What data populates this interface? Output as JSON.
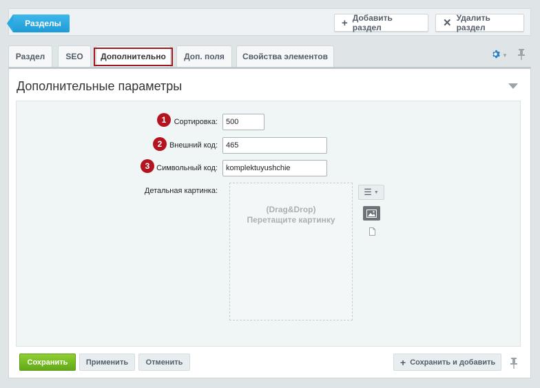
{
  "toolbar": {
    "sections_label": "Разделы",
    "add_section_label": "Добавить раздел",
    "delete_section_label": "Удалить раздел"
  },
  "tabs": [
    {
      "label": "Раздел"
    },
    {
      "label": "SEO"
    },
    {
      "label": "Дополнительно",
      "active": true
    },
    {
      "label": "Доп. поля"
    },
    {
      "label": "Свойства элементов"
    }
  ],
  "panel": {
    "title": "Дополнительные параметры"
  },
  "form": {
    "sort": {
      "marker": "1",
      "label": "Сортировка:",
      "value": "500"
    },
    "external_code": {
      "marker": "2",
      "label": "Внешний код:",
      "value": "465"
    },
    "symbolic_code": {
      "marker": "3",
      "label": "Символьный код:",
      "value": "komplektuyushchie"
    },
    "picture": {
      "label": "Детальная картинка:",
      "drop_line1": "(Drag&Drop)",
      "drop_line2": "Перетащите картинку"
    }
  },
  "footer": {
    "save_label": "Сохранить",
    "apply_label": "Применить",
    "cancel_label": "Отменить",
    "save_add_label": "Сохранить и добавить"
  },
  "colors": {
    "accent_blue": "#1e9bd7",
    "save_green": "#62a817",
    "marker_red": "#b4141f",
    "active_tab_outline": "#a3151f"
  },
  "icons": [
    "plus-icon",
    "close-icon",
    "gear-icon",
    "pin-icon",
    "menu-icon",
    "image-icon",
    "file-icon",
    "collapse-arrow-icon"
  ]
}
